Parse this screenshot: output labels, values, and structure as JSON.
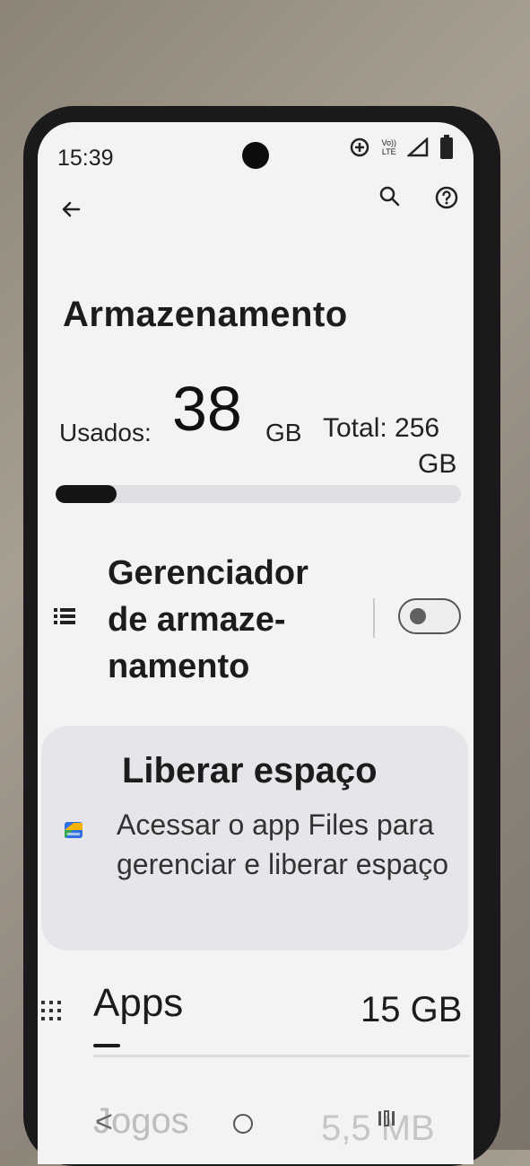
{
  "status_bar": {
    "time": "15:39",
    "icons": [
      "sync-icon",
      "volte-icon",
      "signal-icon",
      "battery-icon"
    ],
    "volte_text_top": "Vo))",
    "volte_text_bottom": "LTE"
  },
  "toolbar": {
    "icons": [
      "back-arrow-icon",
      "search-icon",
      "help-icon"
    ]
  },
  "page": {
    "title": "Armazenamento"
  },
  "storage": {
    "used_label": "Usados:",
    "used_value": "38",
    "used_unit": "GB",
    "total_label": "Total: 256",
    "total_unit": "GB",
    "used_fraction": 0.15
  },
  "storage_manager": {
    "icon": "list-icon",
    "title": "Gerenciador de armaze-namento",
    "enabled": false
  },
  "free_space_card": {
    "icon": "files-app-icon",
    "title": "Liberar espaço",
    "description": "Acessar o app Files para gerenciar e liberar espaço"
  },
  "categories": [
    {
      "icon": "apps-grid-icon",
      "label": "Apps",
      "size": "15 GB"
    },
    {
      "icon": "games-icon",
      "label": "Jogos",
      "size": "5,5 MB"
    }
  ],
  "nav_bar": {
    "back_glyph": "<",
    "icons": [
      "nav-back-icon",
      "nav-home-icon",
      "nav-recents-icon"
    ]
  },
  "colors": {
    "screen_bg": "#f3f3f4",
    "card_bg": "#e6e6ea",
    "progress_fill": "#141414",
    "progress_track": "#dedee3"
  }
}
